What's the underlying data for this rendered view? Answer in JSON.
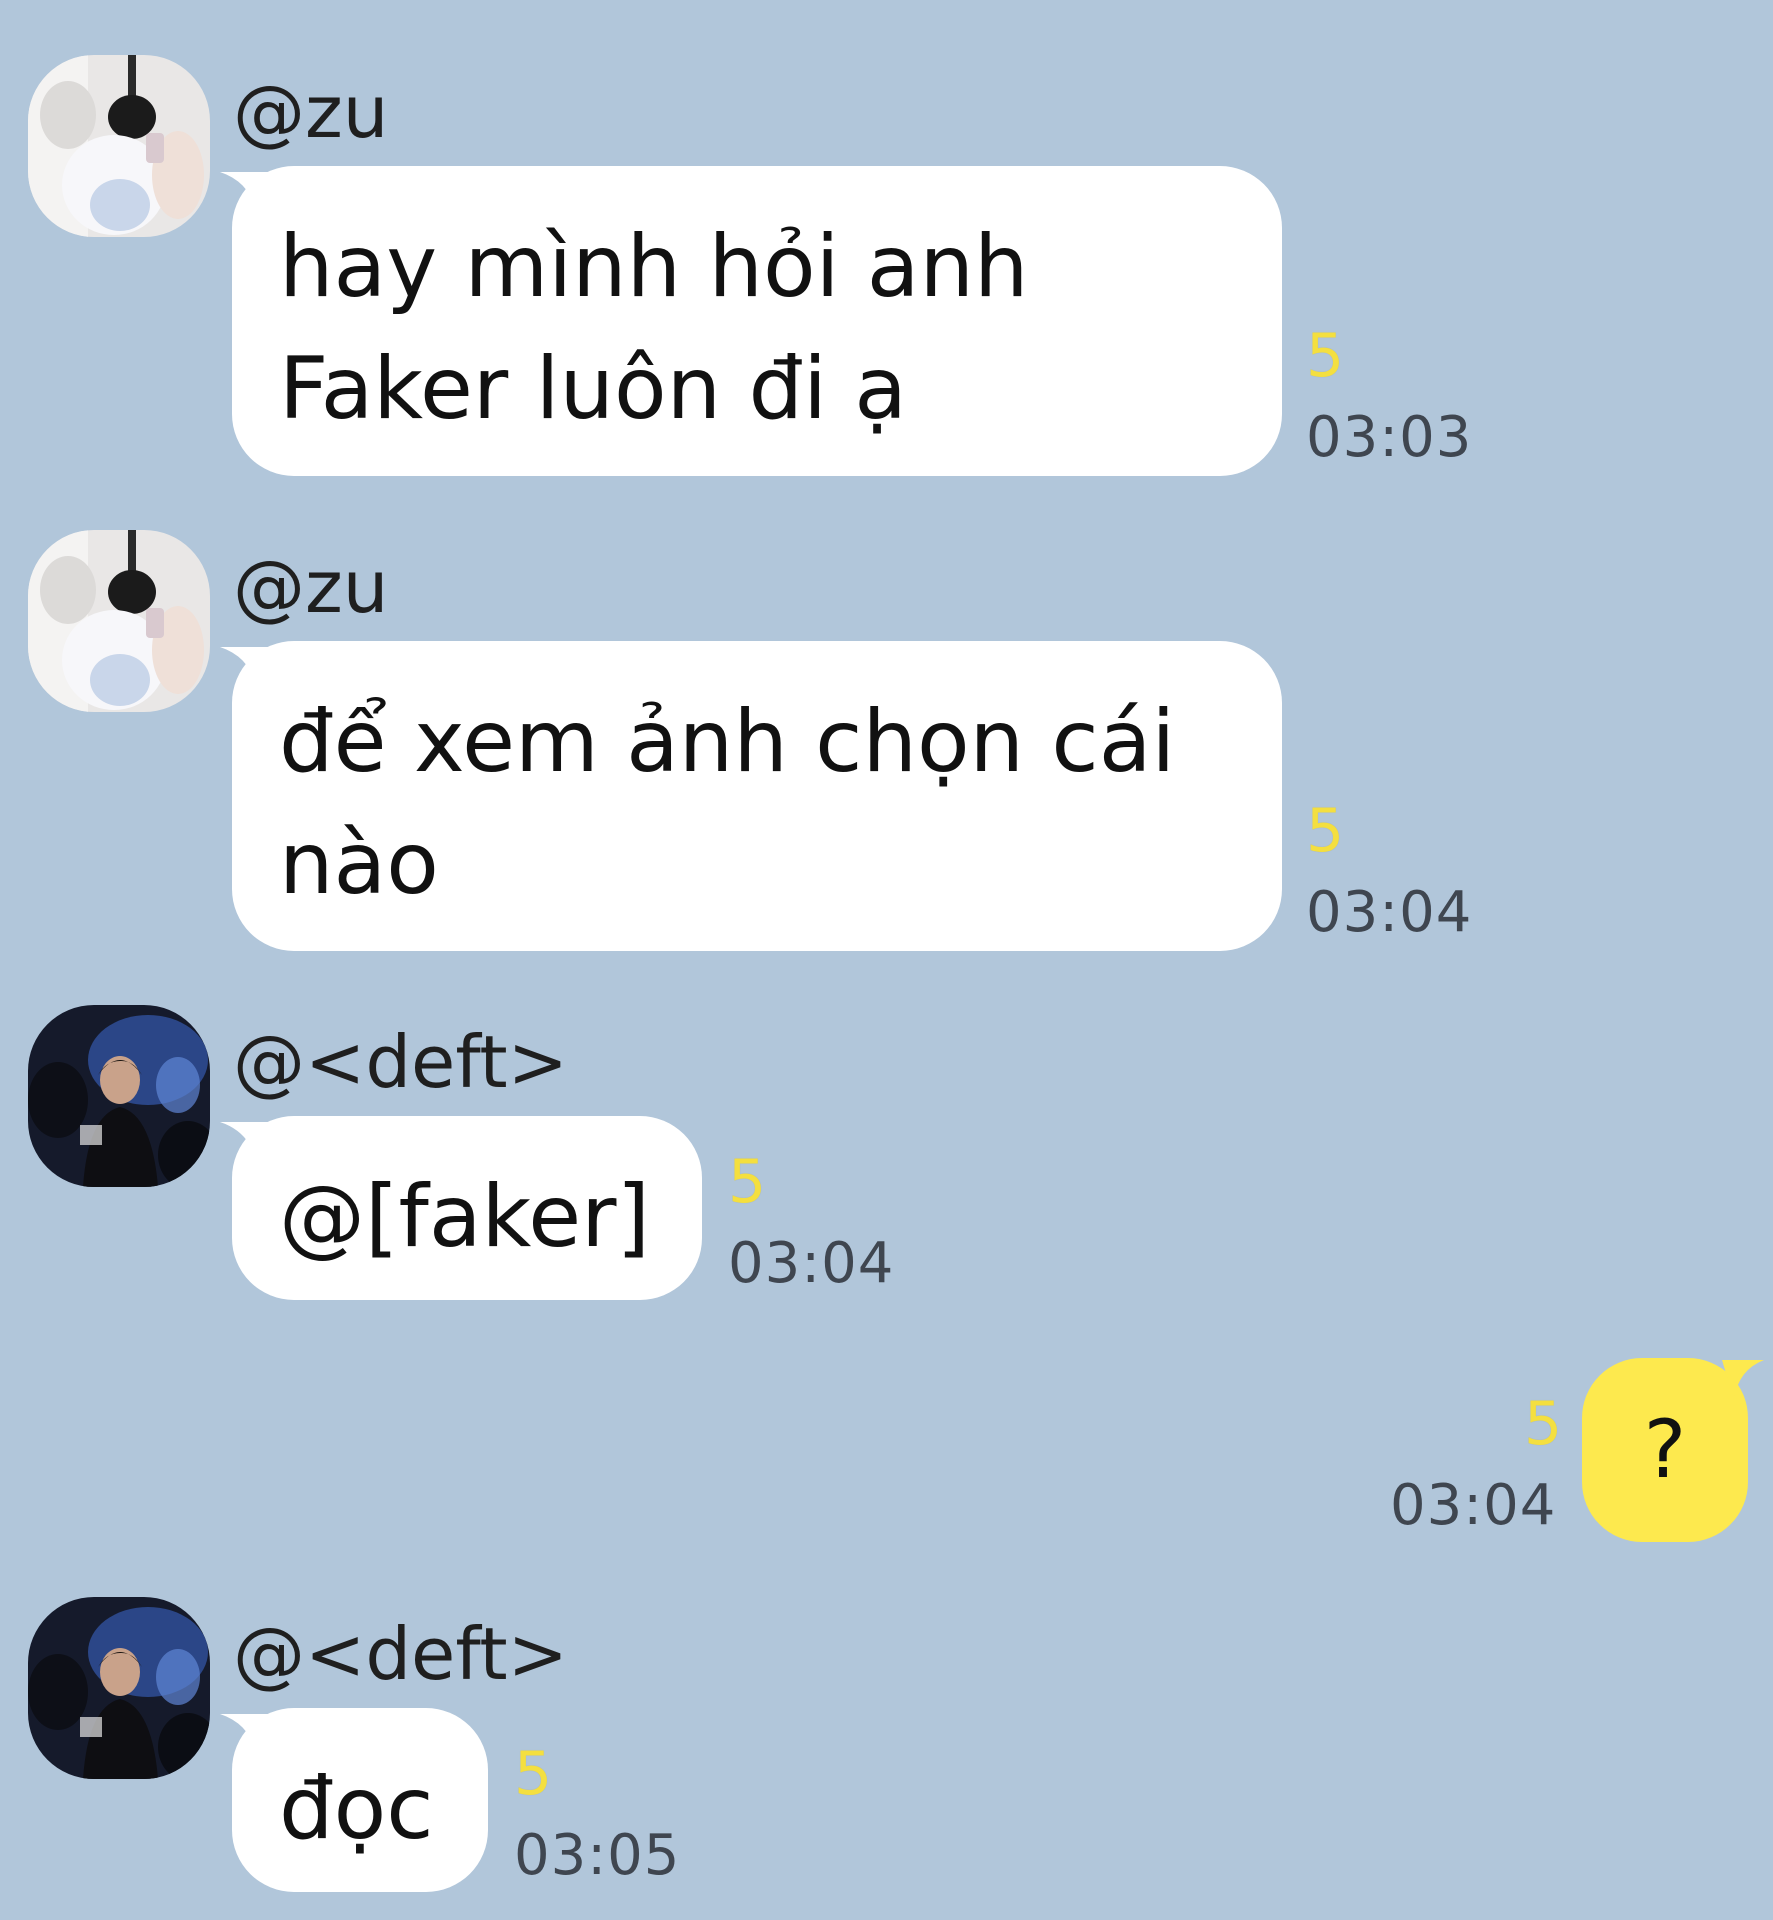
{
  "messages": [
    {
      "sender": "@zu",
      "lines": [
        "hay mình hỏi anh",
        "Faker luôn đi ạ"
      ],
      "unread": "5",
      "time": "03:03",
      "avatar": "zu-avatar"
    },
    {
      "sender": "@zu",
      "lines": [
        "để xem ảnh chọn cái",
        "nào"
      ],
      "unread": "5",
      "time": "03:04",
      "avatar": "zu-avatar"
    },
    {
      "sender": "@<deft>",
      "lines": [
        "@[faker]"
      ],
      "unread": "5",
      "time": "03:04",
      "avatar": "deft-avatar"
    },
    {
      "sender": "",
      "lines": [
        "?"
      ],
      "unread": "5",
      "time": "03:04",
      "mine": true
    },
    {
      "sender": "@<deft>",
      "lines": [
        "đọc"
      ],
      "unread": "5",
      "time": "03:05",
      "avatar": "deft-avatar"
    }
  ],
  "colors": {
    "background": "#b1c6da",
    "incoming_bubble": "#ffffff",
    "outgoing_bubble": "#fde94e",
    "unread_count": "#f4df3f",
    "timestamp": "#3f4650"
  }
}
